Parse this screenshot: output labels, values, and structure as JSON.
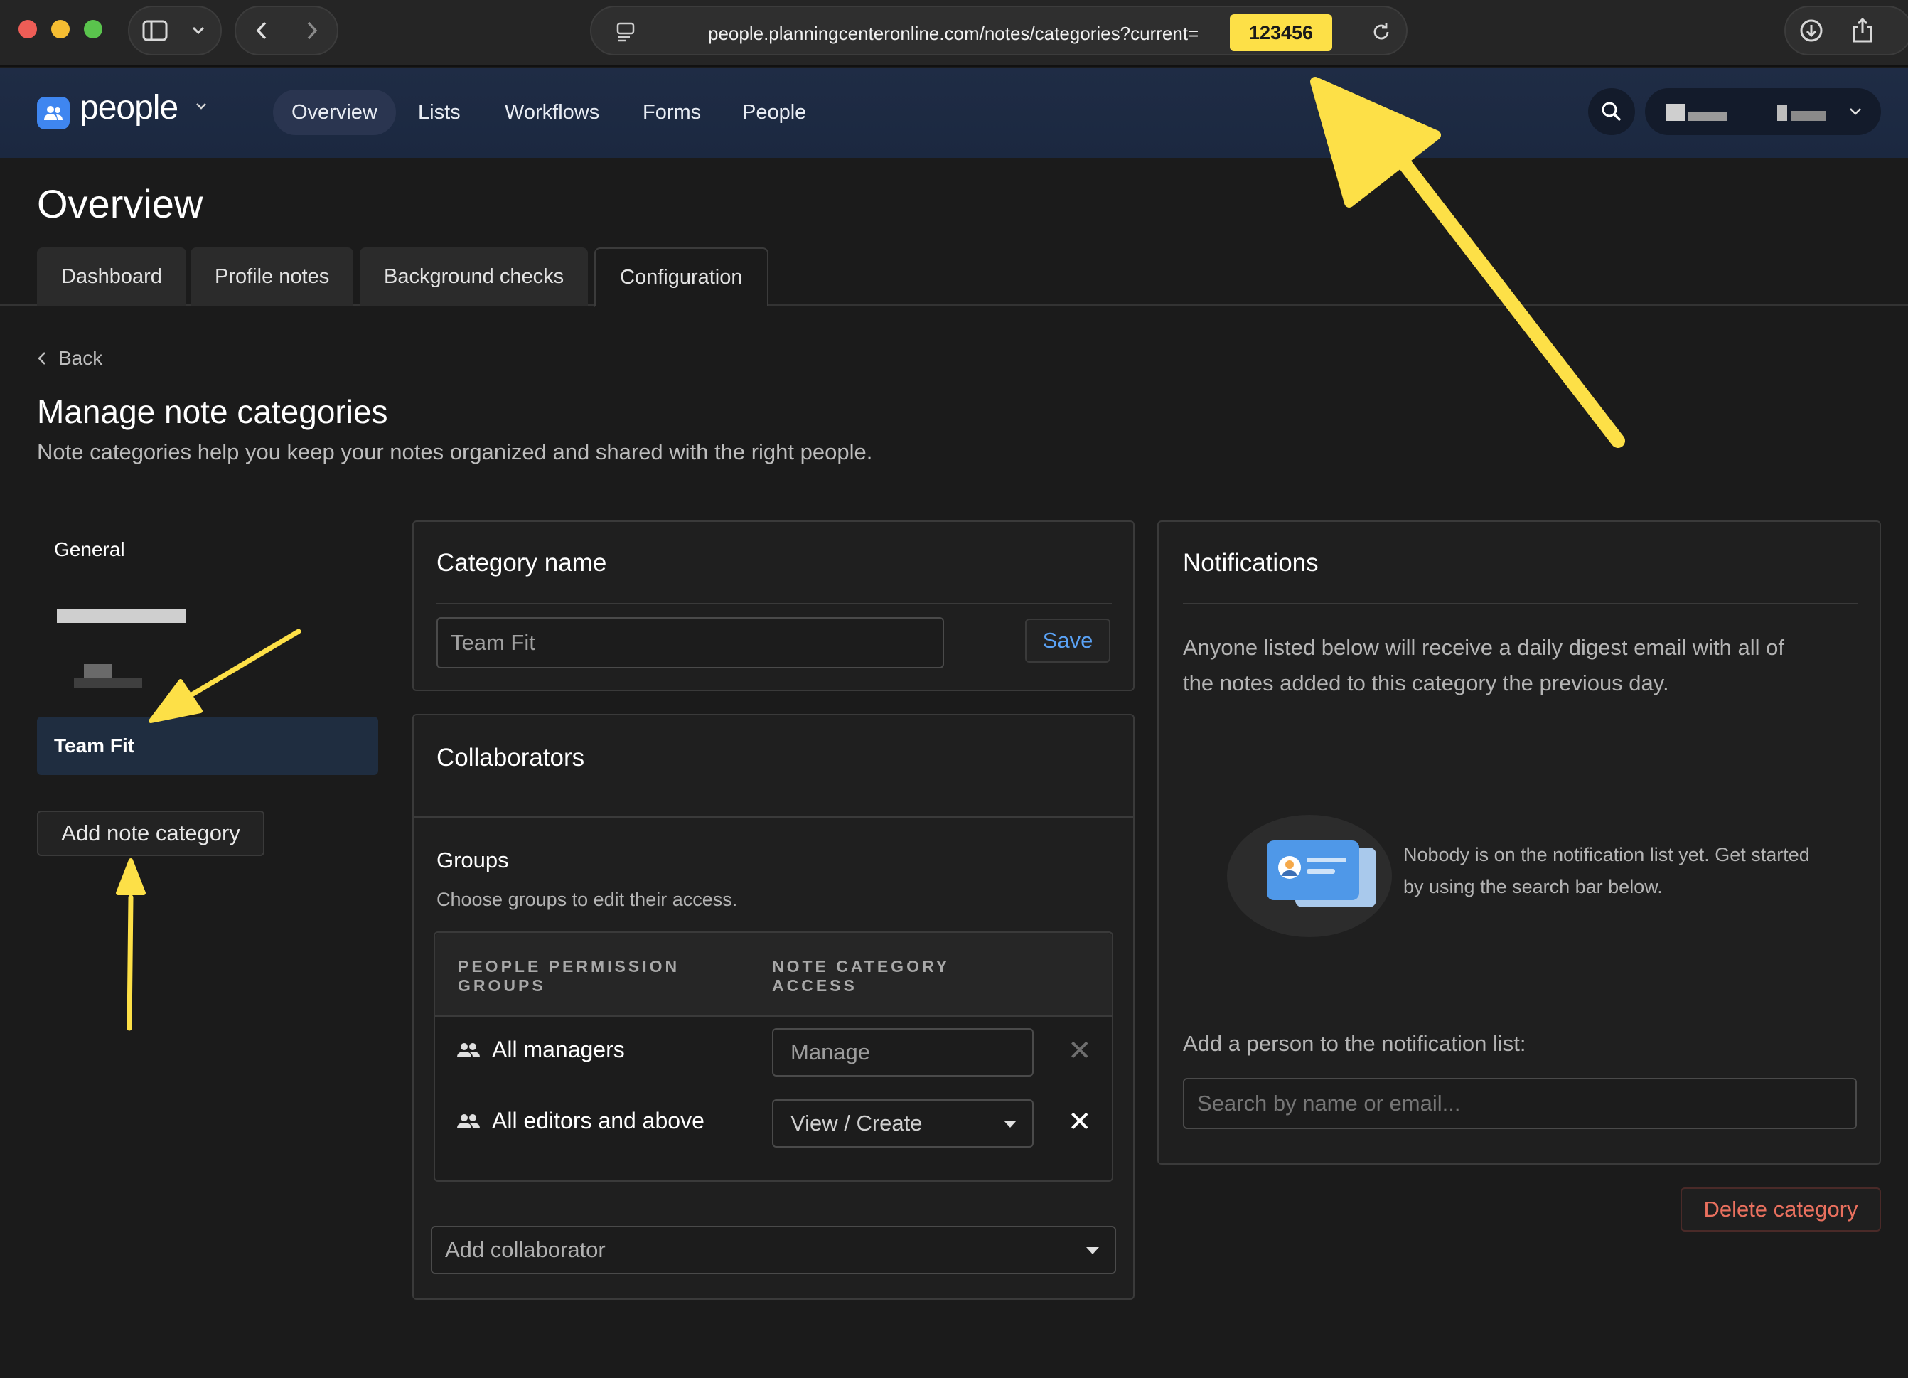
{
  "browser": {
    "url": "people.planningcenteronline.com/notes/categories?current=",
    "url_highlight": "123456"
  },
  "app": {
    "name": "people",
    "nav": [
      "Overview",
      "Lists",
      "Workflows",
      "Forms",
      "People"
    ],
    "active_nav": "Overview"
  },
  "page": {
    "title": "Overview",
    "tabs": [
      "Dashboard",
      "Profile notes",
      "Background checks",
      "Configuration"
    ],
    "active_tab": "Configuration",
    "back_label": "Back",
    "heading": "Manage note categories",
    "subheading": "Note categories help you keep your notes organized and shared with the right people."
  },
  "sidebar": {
    "categories": [
      "General",
      "Team Fit"
    ],
    "active_category": "Team Fit",
    "add_button": "Add note category"
  },
  "category_panel": {
    "title": "Category name",
    "name_value": "Team Fit",
    "save_label": "Save"
  },
  "collaborators": {
    "title": "Collaborators",
    "groups_title": "Groups",
    "groups_help": "Choose groups to edit their access.",
    "col_group": "PEOPLE PERMISSION\nGROUPS",
    "col_access": "NOTE CATEGORY\nACCESS",
    "rows": [
      {
        "name": "All managers",
        "access": "Manage"
      },
      {
        "name": "All editors and above",
        "access": "View / Create"
      }
    ],
    "add_placeholder": "Add collaborator"
  },
  "notifications": {
    "title": "Notifications",
    "description": "Anyone listed below will receive a daily digest email with all of the notes added to this category the previous day.",
    "empty_text": "Nobody is on the notification list yet. Get started by using the search bar below.",
    "add_label": "Add a person to the notification list:",
    "search_placeholder": "Search by name or email..."
  },
  "actions": {
    "delete_label": "Delete category"
  },
  "colors": {
    "accent": "#3f86f0",
    "annotation": "#fde047",
    "danger": "#e9705e",
    "nav_bg": "#1f2c45"
  }
}
